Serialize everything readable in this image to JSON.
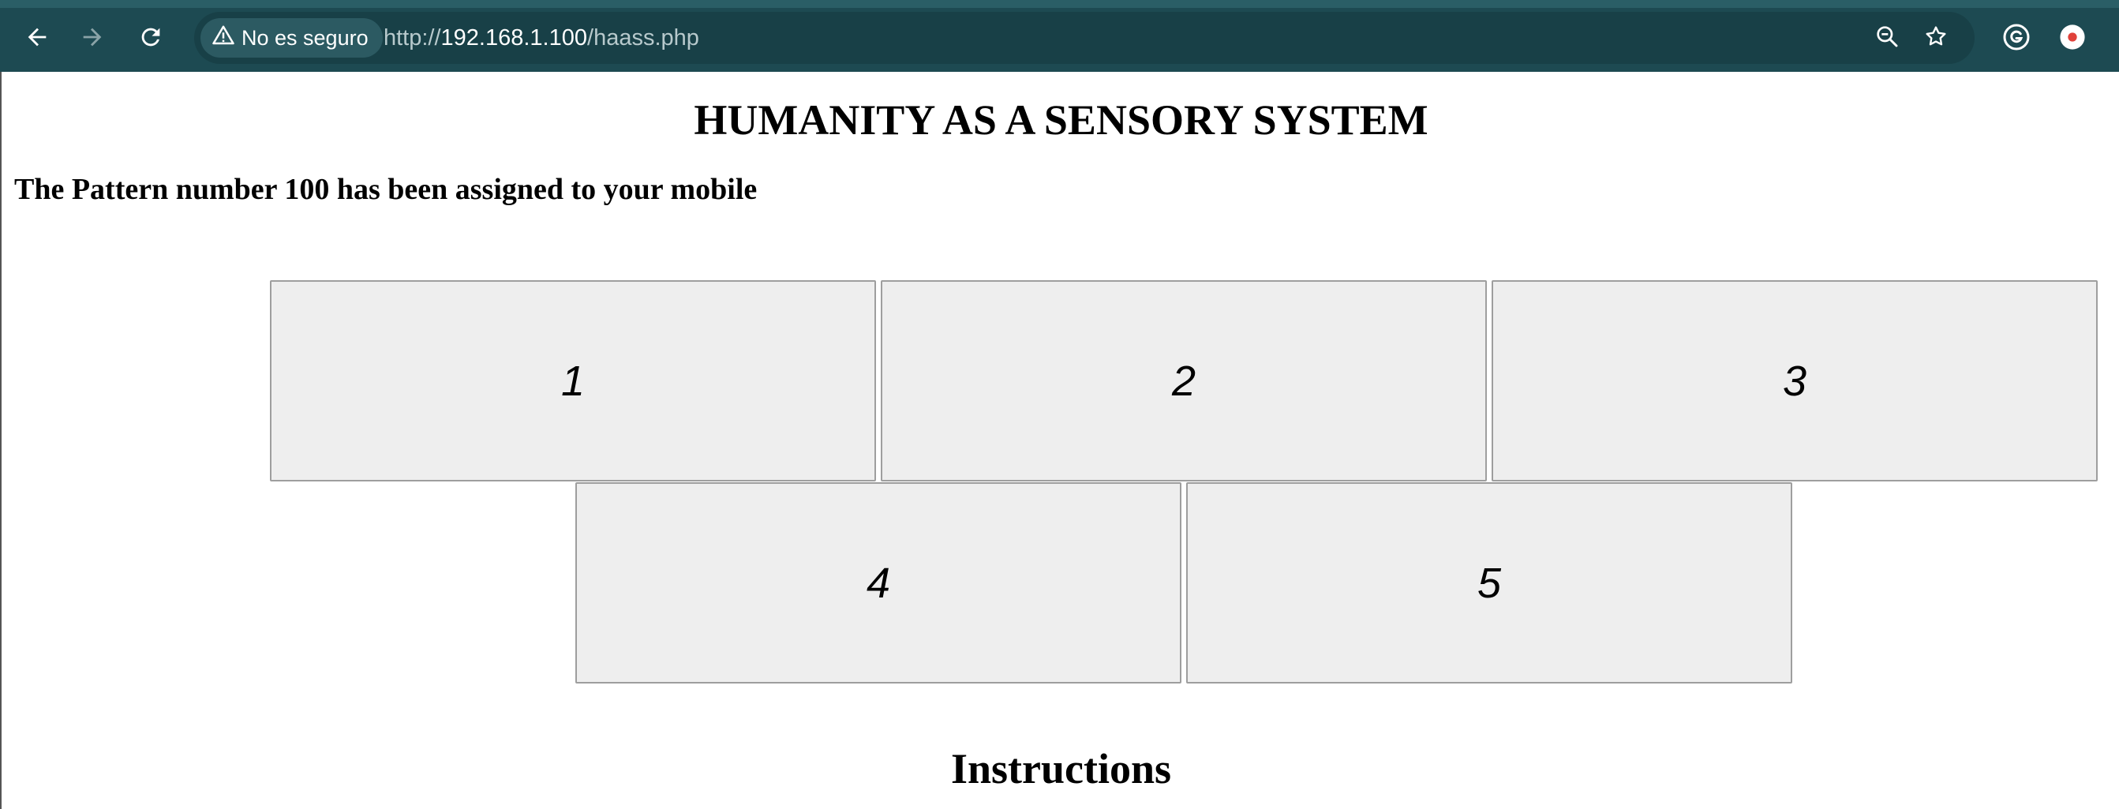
{
  "browser": {
    "security_label": "No es seguro",
    "url_scheme": "http://",
    "url_host": "192.168.1.100",
    "url_path": "/haass.php",
    "icons": [
      "back-icon",
      "forward-icon",
      "reload-icon",
      "warning-icon",
      "zoom-out-icon",
      "star-icon",
      "grammarly-icon",
      "profile-icon"
    ],
    "colors": {
      "toolbar": "#1d4a52",
      "omnibox": "#184047",
      "record_dot": "#e0413a"
    }
  },
  "page": {
    "title": "HUMANITY AS A SENSORY SYSTEM",
    "assigned_message": "The Pattern number 100 has been assigned to your mobile",
    "buttons": [
      {
        "label": "1"
      },
      {
        "label": "2"
      },
      {
        "label": "3"
      },
      {
        "label": "4"
      },
      {
        "label": "5"
      }
    ],
    "instructions_heading": "Instructions",
    "colors": {
      "button_bg": "#eeeeee",
      "button_border": "#9e9e9e"
    }
  }
}
